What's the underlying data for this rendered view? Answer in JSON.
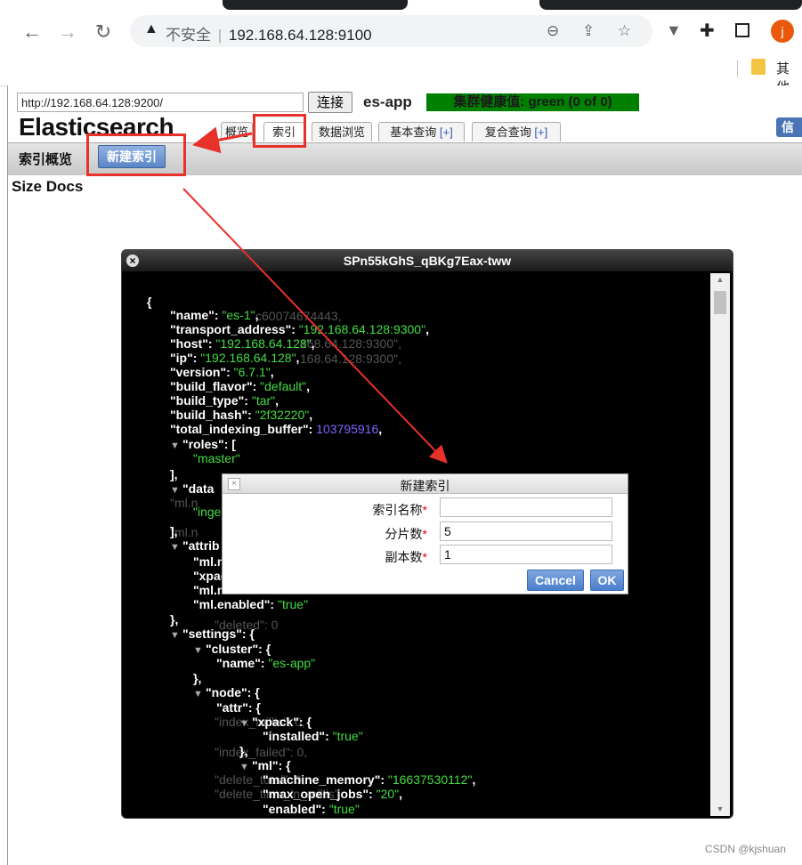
{
  "browser": {
    "security_label": "不安全",
    "separator": "|",
    "url": "192.168.64.128:9100",
    "avatar_letter": "j",
    "bookmark_label": "其他"
  },
  "app": {
    "url_value": "http://192.168.64.128:9200/",
    "connect_label": "连接",
    "cluster_name": "es-app",
    "health": "集群健康值: green (0 of 0)",
    "logo": "Elasticsearch",
    "tabs": [
      {
        "label": "概览"
      },
      {
        "label": "索引"
      },
      {
        "label": "数据浏览"
      },
      {
        "label": "基本查询",
        "plus": "[+]"
      },
      {
        "label": "复合查询",
        "plus": "[+]"
      }
    ],
    "info_label": "信息",
    "toolbar_label": "索引概览",
    "new_index_label": "新建索引",
    "size_docs": "Size Docs"
  },
  "json_dialog": {
    "title": "SPn55kGhS_qBKg7Eax-tww",
    "lines": [
      {
        "k": "{"
      },
      {
        "k": "\"name\": ",
        "s": "\"es-1\"",
        "e": ","
      },
      {
        "k": "\"transport_address\": ",
        "s": "\"192.168.64.128:9300\"",
        "e": ","
      },
      {
        "k": "\"host\": ",
        "s": "\"192.168.64.128\"",
        "e": ","
      },
      {
        "k": "\"ip\": ",
        "s": "\"192.168.64.128\"",
        "e": ","
      },
      {
        "k": "\"version\": ",
        "s": "\"6.7.1\"",
        "e": ","
      },
      {
        "k": "\"build_flavor\": ",
        "s": "\"default\"",
        "e": ","
      },
      {
        "k": "\"build_type\": ",
        "s": "\"tar\"",
        "e": ","
      },
      {
        "k": "\"build_hash\": ",
        "s": "\"2f32220\"",
        "e": ","
      },
      {
        "k": "\"total_indexing_buffer\": ",
        "n": "103795916",
        "e": ","
      },
      {
        "t": true,
        "k": "\"roles\": ["
      },
      {
        "s": "\"master\""
      },
      {
        "k": "],"
      },
      {
        "t": true,
        "k": "\"data"
      },
      {
        "s": "\"inge"
      },
      {
        "k": "],"
      },
      {
        "t": true,
        "k": "\"attrib"
      },
      {
        "k": "\"ml.m"
      },
      {
        "k": "\"xpac"
      },
      {
        "k": "\"ml.m"
      },
      {
        "k": "\"ml.enabled\": ",
        "s": "\"true\""
      },
      {
        "k": "},"
      },
      {
        "t": true,
        "k": "\"settings\": {"
      },
      {
        "t": true,
        "k": "\"cluster\": {"
      },
      {
        "k": "\"name\": ",
        "s": "\"es-app\""
      },
      {
        "k": "},"
      },
      {
        "t": true,
        "k": "\"node\": {"
      },
      {
        "k": "\"attr\": {"
      },
      {
        "t": true,
        "k": "\"xpack\": {"
      },
      {
        "k": "\"installed\": ",
        "s": "\"true\""
      },
      {
        "k": "},"
      },
      {
        "t": true,
        "k": "\"ml\": {"
      },
      {
        "k": "\"machine_memory\": ",
        "s": "\"16637530112\"",
        "e": ","
      },
      {
        "k": "\"max_open_jobs\": ",
        "s": "\"20\"",
        "e": ","
      },
      {
        "k": "\"enabled\": ",
        "s": "\"true\""
      }
    ],
    "ghosts": [
      "c60074674443,",
      "168.64.128:9300\",",
      "168.64.128:9300\",",
      "\"ml.n",
      "\"ml.n",
      "\"deleted\": 0",
      "\"index_millis\": 0,",
      "\"index_failed\": 0,",
      "\"delete_total\": 0,",
      "\"delete_time_in_millis\"",
      "\"noop_update_total\""
    ]
  },
  "modal": {
    "title": "新建索引",
    "fields": [
      {
        "label": "索引名称",
        "value": ""
      },
      {
        "label": "分片数",
        "value": "5"
      },
      {
        "label": "副本数",
        "value": "1"
      }
    ],
    "required_mark": "*",
    "cancel_label": "Cancel",
    "ok_label": "OK"
  },
  "watermark": "CSDN @kjshuan",
  "colors": {
    "health_green": "#008000",
    "annotation_red": "#e8312a",
    "button_blue": "#5a86c8"
  }
}
